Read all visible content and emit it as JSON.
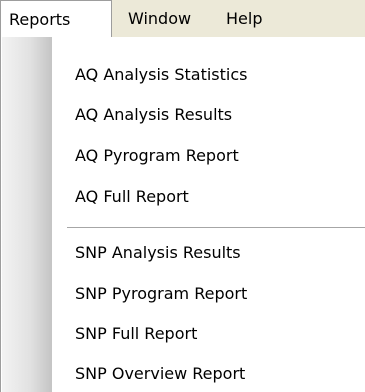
{
  "menubar": {
    "items": [
      {
        "label": "Reports"
      },
      {
        "label": "Window"
      },
      {
        "label": "Help"
      }
    ]
  },
  "reports_menu": {
    "aq_items": [
      {
        "label": "AQ Analysis Statistics"
      },
      {
        "label": "AQ Analysis Results"
      },
      {
        "label": "AQ Pyrogram Report"
      },
      {
        "label": "AQ Full Report"
      }
    ],
    "snp_items": [
      {
        "label": "SNP Analysis Results"
      },
      {
        "label": "SNP Pyrogram Report"
      },
      {
        "label": "SNP Full Report"
      },
      {
        "label": "SNP Overview Report"
      }
    ]
  }
}
